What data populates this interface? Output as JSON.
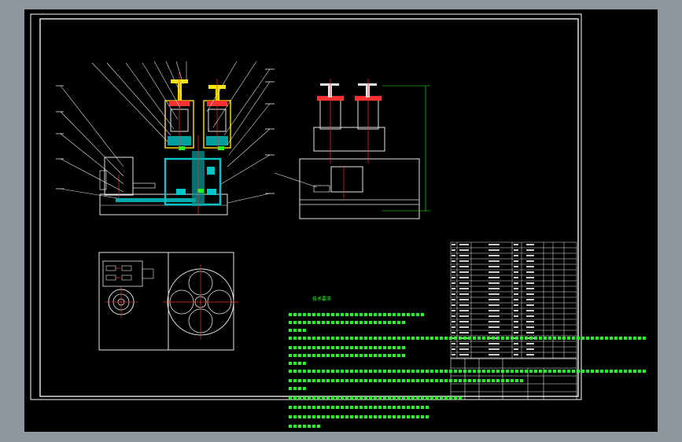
{
  "colors": {
    "background": "#8f969e",
    "paper": "#000000",
    "frame": "#ffffff",
    "outline": "#e6e6e6",
    "centerline": "#ff3030",
    "dimension": "#22ff22",
    "component": "#00c8c8",
    "valve": "#ffe600"
  },
  "notes": {
    "title": "技术要求"
  }
}
